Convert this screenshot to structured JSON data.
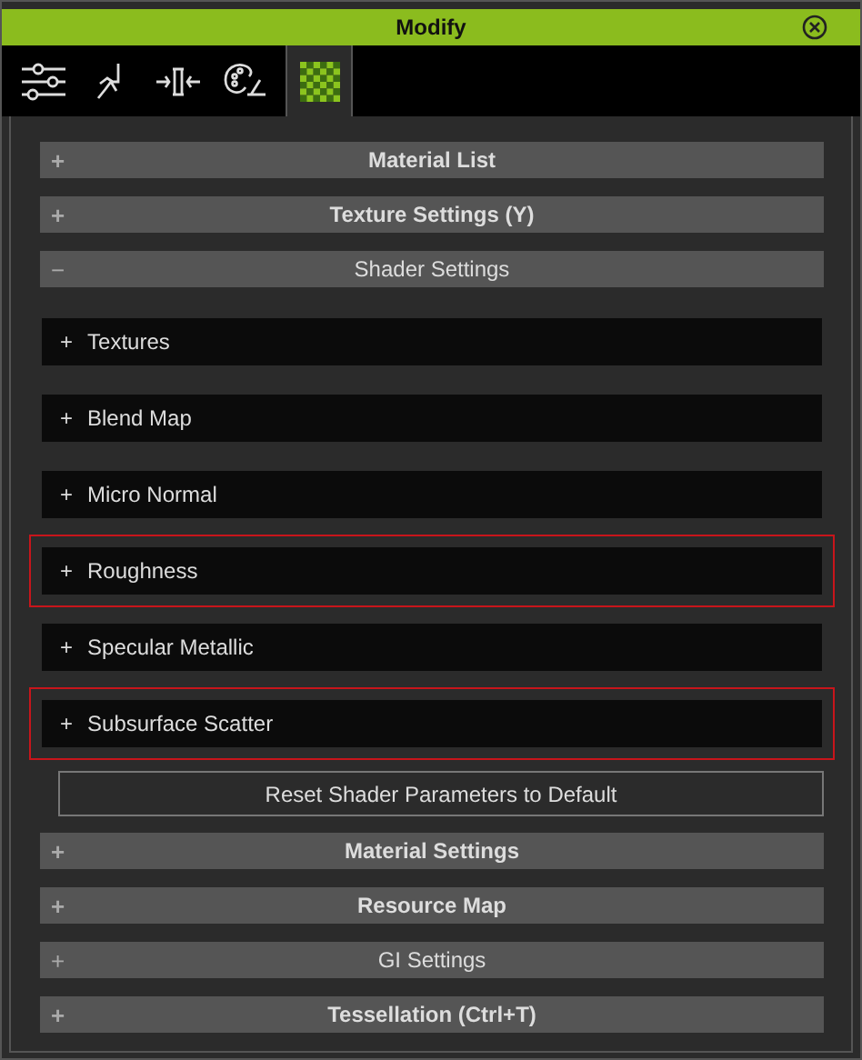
{
  "window": {
    "title": "Modify"
  },
  "tabs": [
    {
      "kind": "sliders",
      "selected": false
    },
    {
      "kind": "figure",
      "selected": false
    },
    {
      "kind": "compress",
      "selected": false
    },
    {
      "kind": "palette",
      "selected": false
    },
    {
      "kind": "checker",
      "selected": true
    }
  ],
  "top_sections": [
    {
      "label": "Material List",
      "expanded": false,
      "bold": true
    },
    {
      "label": "Texture Settings  (Y)",
      "expanded": false,
      "bold": true
    },
    {
      "label": "Shader Settings",
      "expanded": true,
      "bold": false
    }
  ],
  "shader_groups": [
    {
      "label": "Textures",
      "highlighted": false
    },
    {
      "label": "Blend Map",
      "highlighted": false
    },
    {
      "label": "Micro Normal",
      "highlighted": false
    },
    {
      "label": "Roughness",
      "highlighted": true
    },
    {
      "label": "Specular Metallic",
      "highlighted": false
    },
    {
      "label": "Subsurface Scatter",
      "highlighted": true
    }
  ],
  "group_toggle": "+",
  "section_signs": {
    "collapsed": "+",
    "expanded": "−"
  },
  "reset_button": "Reset Shader Parameters to Default",
  "bottom_sections": [
    {
      "label": "Material Settings",
      "expanded": false,
      "bold": true
    },
    {
      "label": "Resource Map",
      "expanded": false,
      "bold": true
    },
    {
      "label": "GI Settings",
      "expanded": false,
      "bold": false
    },
    {
      "label": "Tessellation  (Ctrl+T)",
      "expanded": false,
      "bold": true
    }
  ]
}
